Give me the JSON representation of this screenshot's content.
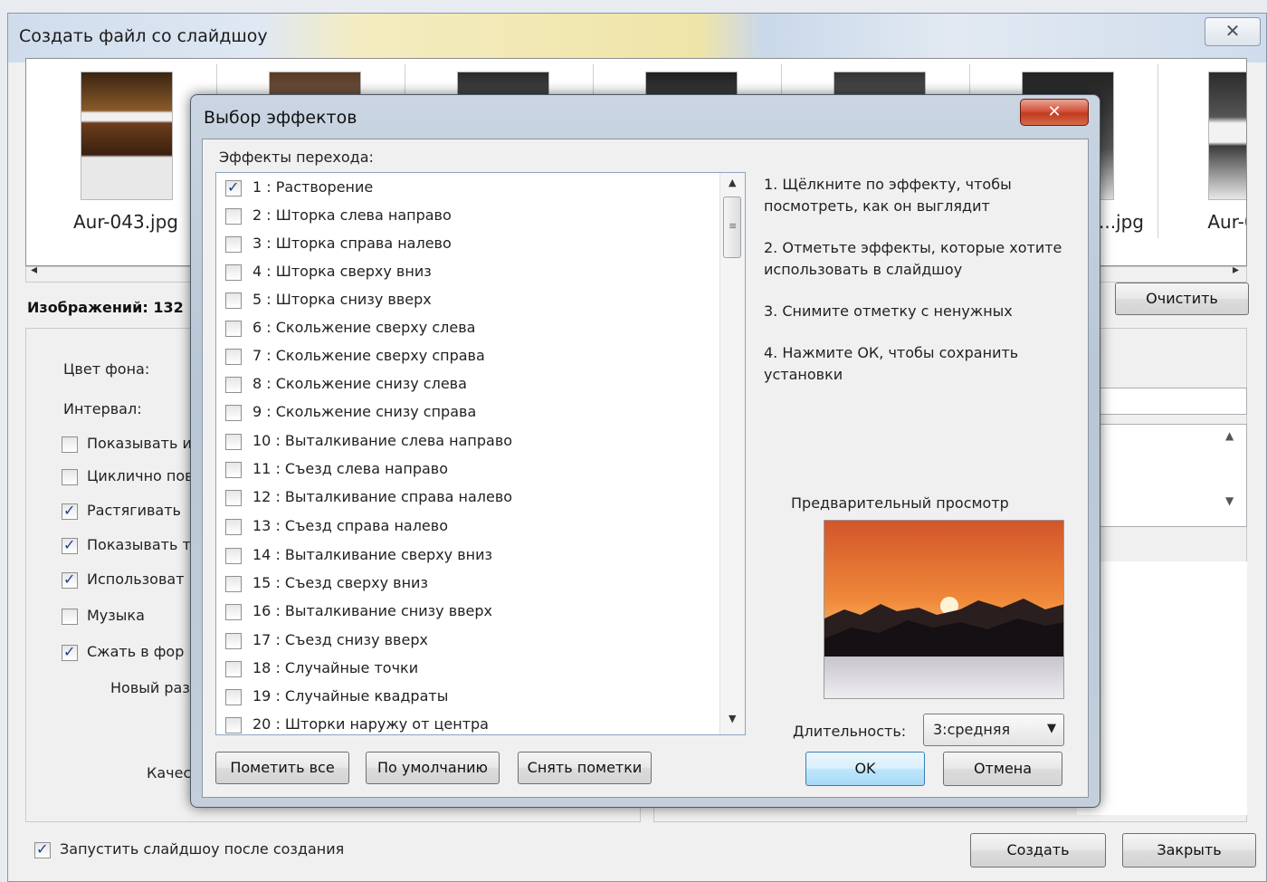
{
  "main_window": {
    "title": "Создать файл со слайдшоу",
    "close_glyph": "✕",
    "thumbnails": [
      {
        "label": "Aur-043.jpg"
      },
      {
        "label": ""
      },
      {
        "label": ""
      },
      {
        "label": ""
      },
      {
        "label": ""
      },
      {
        "label": "...jpg"
      },
      {
        "label": "Aur-0"
      }
    ],
    "images_count": "Изображений: 132",
    "clear_button": "Очистить",
    "bg_color_label": "Цвет фона:",
    "interval_label": "Интервал:",
    "options": [
      {
        "label": "Показывать и",
        "checked": false
      },
      {
        "label": "Циклично пов",
        "checked": false
      },
      {
        "label": "Растягивать",
        "checked": true
      },
      {
        "label": "Показывать т",
        "checked": true
      },
      {
        "label": "Использоват",
        "checked": true
      },
      {
        "label": "Музыка",
        "checked": false
      },
      {
        "label": "Сжать в фор",
        "checked": true
      }
    ],
    "new_size_label": "Новый раз",
    "quality_label": "Качес",
    "run_after_label": "Запустить слайдшоу после создания",
    "run_after_checked": true,
    "create_button": "Создать",
    "close_button": "Закрыть"
  },
  "effects_dialog": {
    "title": "Выбор эффектов",
    "close_glyph": "✕",
    "heading": "Эффекты перехода:",
    "effects": [
      {
        "label": "1 : Растворение",
        "checked": true
      },
      {
        "label": "2 : Шторка слева направо",
        "checked": false
      },
      {
        "label": "3 : Шторка справа налево",
        "checked": false
      },
      {
        "label": "4 : Шторка сверху вниз",
        "checked": false
      },
      {
        "label": "5 : Шторка снизу вверх",
        "checked": false
      },
      {
        "label": "6 : Скольжение сверху слева",
        "checked": false
      },
      {
        "label": "7 : Скольжение сверху справа",
        "checked": false
      },
      {
        "label": "8 : Скольжение снизу слева",
        "checked": false
      },
      {
        "label": "9 : Скольжение снизу справа",
        "checked": false
      },
      {
        "label": "10 : Выталкивание слева направо",
        "checked": false
      },
      {
        "label": "11 : Съезд слева направо",
        "checked": false
      },
      {
        "label": "12 : Выталкивание справа налево",
        "checked": false
      },
      {
        "label": "13 : Съезд справа налево",
        "checked": false
      },
      {
        "label": "14 : Выталкивание сверху вниз",
        "checked": false
      },
      {
        "label": "15 : Съезд сверху вниз",
        "checked": false
      },
      {
        "label": "16 : Выталкивание снизу вверх",
        "checked": false
      },
      {
        "label": "17 : Съезд снизу вверх",
        "checked": false
      },
      {
        "label": "18 : Случайные точки",
        "checked": false
      },
      {
        "label": "19 : Случайные квадраты",
        "checked": false
      },
      {
        "label": "20 : Шторки наружу от центра",
        "checked": false
      }
    ],
    "instructions": [
      "1. Щёлкните по эффекту, чтобы посмотреть, как он выглядит",
      "2. Отметьте эффекты, которые хотите использовать в слайдшоу",
      "3. Снимите отметку с ненужных",
      "4. Нажмите ОК, чтобы сохранить установки"
    ],
    "preview_label": "Предварительный просмотр",
    "duration_label": "Длительность:",
    "duration_value": "3:средняя",
    "mark_all_button": "Пометить все",
    "default_button": "По умолчанию",
    "unmark_button": "Снять пометки",
    "ok_button": "OK",
    "cancel_button": "Отмена"
  },
  "colors": {
    "dialog_frame": "#b9c6d5",
    "close_red": "#c2391f",
    "ok_blue": "#bee6fd",
    "check_blue": "#1b3d8f"
  }
}
